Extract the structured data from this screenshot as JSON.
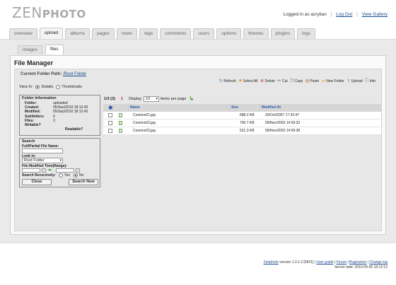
{
  "logo": {
    "zen": "ZEN",
    "photo": "PHOTO"
  },
  "userbar": {
    "logged_in": "Logged in as acrylian",
    "logout": "Log Out",
    "view_gallery": "View Gallery",
    "sep": "|"
  },
  "nav": {
    "tabs": [
      "overview",
      "upload",
      "albums",
      "pages",
      "news",
      "tags",
      "comments",
      "users",
      "options",
      "themes",
      "plugins",
      "logs"
    ],
    "active": "upload"
  },
  "subtabs": {
    "items": [
      "images",
      "files"
    ],
    "active": "files"
  },
  "file_manager": {
    "title": "File Manager",
    "current_folder_label": "Current Folder Path:",
    "current_folder_value": "/Root Folder",
    "view_in_label": "View In:",
    "view_details": "Details",
    "view_thumbnails": "Thumbnails",
    "toolbar": [
      "Refresh",
      "Select All",
      "Delete",
      "Cut",
      "Copy",
      "Paste",
      "New Folder",
      "Upload",
      "Info"
    ],
    "toolbar_icons": [
      "refresh-icon",
      "select-all-icon",
      "delete-icon",
      "cut-icon",
      "copy-icon",
      "paste-icon",
      "new-folder-icon",
      "upload-icon",
      "info-icon"
    ],
    "folder_info": {
      "title": "Folder Information",
      "rows": [
        {
          "k": "Folder:",
          "v": "uploaded"
        },
        {
          "k": "Created:",
          "v": "05/Sep/2010 18:12:43"
        },
        {
          "k": "Modified:",
          "v": "05/Sep/2010 18:12:43"
        },
        {
          "k": "Subfolders:",
          "v": "0"
        },
        {
          "k": "Files:",
          "v": "3"
        },
        {
          "k": "Writable?",
          "v": ""
        }
      ],
      "readable": "Readable?"
    },
    "search": {
      "title": "Search",
      "name_label": "Full/Partial File Name:",
      "look_in_label": "Look in:",
      "look_in_value": "Root Folder",
      "modified_label": "File Modified Time(Range):",
      "recursive_label": "Search Recursively:",
      "yes": "Yes",
      "no": "No",
      "close": "Close",
      "search_now": "Search Now"
    },
    "pager": {
      "count": "1/3 (3)",
      "page": "1",
      "display_label": "Display",
      "per_page_value": "10",
      "per_page_label": "items per page"
    },
    "table": {
      "headers": {
        "name": "Name",
        "size": "Size",
        "modified": "Modified At"
      },
      "rows": [
        {
          "name": "Cosmos01.jpg",
          "size": "688.2 KB",
          "modified": "20/Oct/2007 17:32:47"
        },
        {
          "name": "Cosmos02.jpg",
          "size": "700.7 KB",
          "modified": "09/Nov/2003 14:59:33"
        },
        {
          "name": "Cosmos03.jpg",
          "size": "531.3 KB",
          "modified": "09/Nov/2003 14:59:38"
        }
      ]
    }
  },
  "footer": {
    "zenphoto": "Zenphoto",
    "version": "version 1.3.1.2 [5831]",
    "links": [
      "User guide",
      "Forum",
      "Bugtracker",
      "Change log"
    ],
    "server_date": "Server date: 2010-09-05 18:12:12"
  },
  "colors": {
    "link": "#1a4d8f",
    "accent_red": "#c21818",
    "header_blue": "#2a5ca8"
  }
}
